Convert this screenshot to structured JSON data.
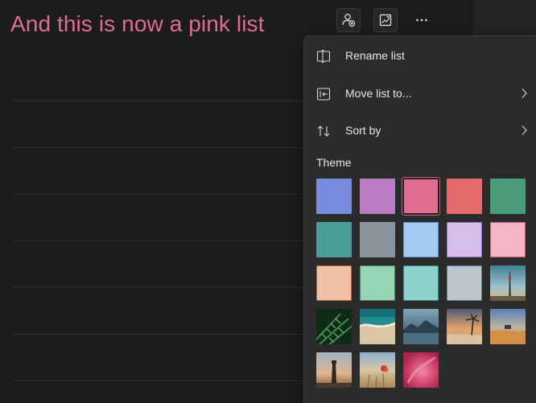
{
  "list": {
    "title": "And this is now a pink list",
    "title_color": "#e06c8f"
  },
  "toolbar": {
    "share_icon": "share-person-icon",
    "suggestions_icon": "suggestions-icon",
    "more_icon": "more-horizontal-icon"
  },
  "menu": {
    "items": [
      {
        "label": "Rename list",
        "icon": "rename-icon",
        "has_submenu": false
      },
      {
        "label": "Move list to...",
        "icon": "move-list-icon",
        "has_submenu": true
      },
      {
        "label": "Sort by",
        "icon": "sort-icon",
        "has_submenu": true
      }
    ],
    "theme_label": "Theme",
    "selected_theme": "pink",
    "themes": [
      {
        "name": "blue",
        "color": "#788ce0"
      },
      {
        "name": "purple",
        "color": "#bb7cc4"
      },
      {
        "name": "pink",
        "color": "#e06c8f"
      },
      {
        "name": "red",
        "color": "#e56b6b"
      },
      {
        "name": "green",
        "color": "#4a9d78"
      },
      {
        "name": "teal",
        "color": "#4a9d96"
      },
      {
        "name": "gray",
        "color": "#8a949d"
      },
      {
        "name": "light-blue",
        "color": "#a3cbf2"
      },
      {
        "name": "lavender",
        "color": "#d7bde9"
      },
      {
        "name": "light-pink",
        "color": "#f4b6c6"
      },
      {
        "name": "peach",
        "color": "#efc1a6"
      },
      {
        "name": "mint",
        "color": "#97d5b5"
      },
      {
        "name": "aqua",
        "color": "#8ed3cb"
      },
      {
        "name": "light-gray",
        "color": "#bbc6cf"
      },
      {
        "name": "photo-tower",
        "color": "#6a8fa0"
      },
      {
        "name": "photo-fern",
        "color": "#1f4a2c"
      },
      {
        "name": "photo-beach",
        "color": "#4aa5a8"
      },
      {
        "name": "photo-lake",
        "color": "#3f5d72"
      },
      {
        "name": "photo-palms",
        "color": "#b7825a"
      },
      {
        "name": "photo-desert",
        "color": "#d39c5e"
      },
      {
        "name": "photo-lighthouse",
        "color": "#b08a6e"
      },
      {
        "name": "photo-poppy",
        "color": "#a98a6a"
      },
      {
        "name": "photo-petal",
        "color": "#d04d74"
      }
    ]
  }
}
